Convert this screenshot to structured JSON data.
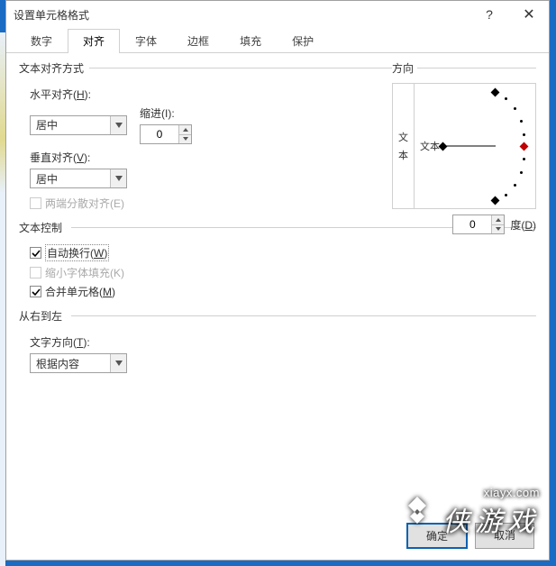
{
  "window": {
    "title": "设置单元格格式"
  },
  "tabs": {
    "items": [
      {
        "label": "数字"
      },
      {
        "label": "对齐",
        "active": true
      },
      {
        "label": "字体"
      },
      {
        "label": "边框"
      },
      {
        "label": "填充"
      },
      {
        "label": "保护"
      }
    ]
  },
  "align": {
    "group_label": "文本对齐方式",
    "horizontal_label_pre": "水平对齐(",
    "horizontal_label_key": "H",
    "horizontal_label_post": "):",
    "horizontal_value": "居中",
    "indent_label": "缩进(I):",
    "indent_value": "0",
    "vertical_label_pre": "垂直对齐(",
    "vertical_label_key": "V",
    "vertical_label_post": "):",
    "vertical_value": "居中",
    "justify_distributed": "两端分散对齐(E)"
  },
  "textctrl": {
    "group_label": "文本控制",
    "wrap_pre": "自动换行(",
    "wrap_key": "W",
    "wrap_post": ")",
    "wrap_checked": true,
    "shrink": "缩小字体填充(K)",
    "shrink_enabled": false,
    "merge_pre": "合并单元格(",
    "merge_key": "M",
    "merge_post": ")",
    "merge_checked": true
  },
  "rtl": {
    "group_label": "从右到左",
    "dir_label_pre": "文字方向(",
    "dir_label_key": "T",
    "dir_label_post": "):",
    "dir_value": "根据内容"
  },
  "orient": {
    "group_label": "方向",
    "vlabel_1": "文",
    "vlabel_2": "本",
    "center_label": "文本",
    "degree_value": "0",
    "degree_label_pre": "度(",
    "degree_label_key": "D",
    "degree_label_post": ")"
  },
  "buttons": {
    "ok": "确定",
    "cancel": "取消"
  },
  "watermark": {
    "url": "xiayx.com",
    "brand": "侠游戏"
  }
}
